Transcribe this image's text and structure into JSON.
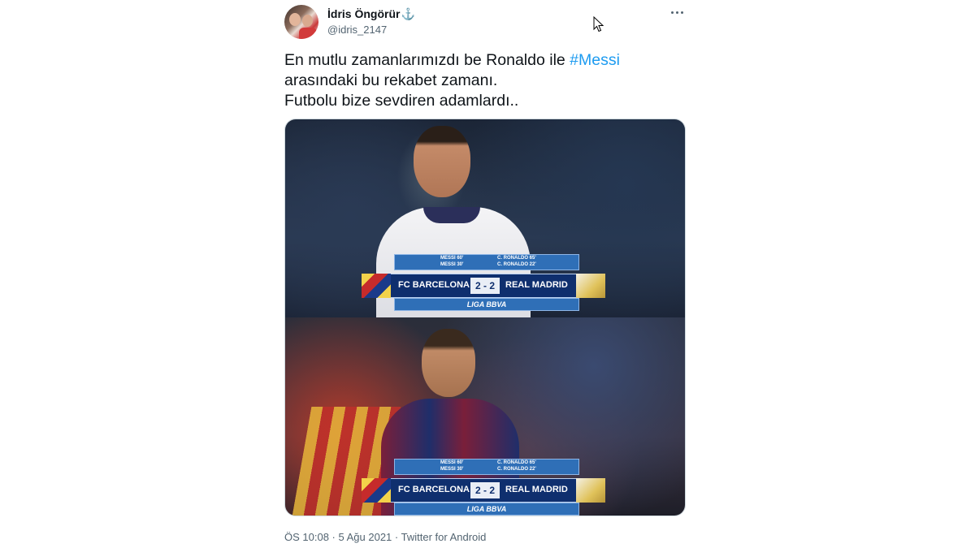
{
  "author": {
    "name": "İdris Öngörür",
    "badge_emoji": "⚓",
    "handle": "@idris_2147"
  },
  "tweet": {
    "text_line1_before": "En mutlu zamanlarımızdı be Ronaldo ile ",
    "hashtag": "#Messi",
    "text_line2": "arasındaki bu rekabet zamanı.",
    "text_line3": "Futbolu bize sevdiren adamlardı.."
  },
  "scoreboard": {
    "scorer_left_1": "MESSI 60'",
    "scorer_left_2": "MESSI 30'",
    "scorer_right_1": "C. RONALDO 65'",
    "scorer_right_2": "C. RONALDO 22'",
    "home_team": "FC BARCELONA",
    "score": "2 - 2",
    "away_team": "REAL MADRID",
    "league": "LIGA BBVA"
  },
  "meta": {
    "time": "ÖS 10:08",
    "sep1": " · ",
    "date": "5 Ağu 2021",
    "sep2": " · ",
    "source": "Twitter for Android"
  },
  "colors": {
    "link": "#1d9bf0",
    "secondary_text": "#536471",
    "primary_text": "#0f1419"
  },
  "icons": {
    "more": "more-options-icon",
    "cursor": "mouse-cursor-icon"
  }
}
